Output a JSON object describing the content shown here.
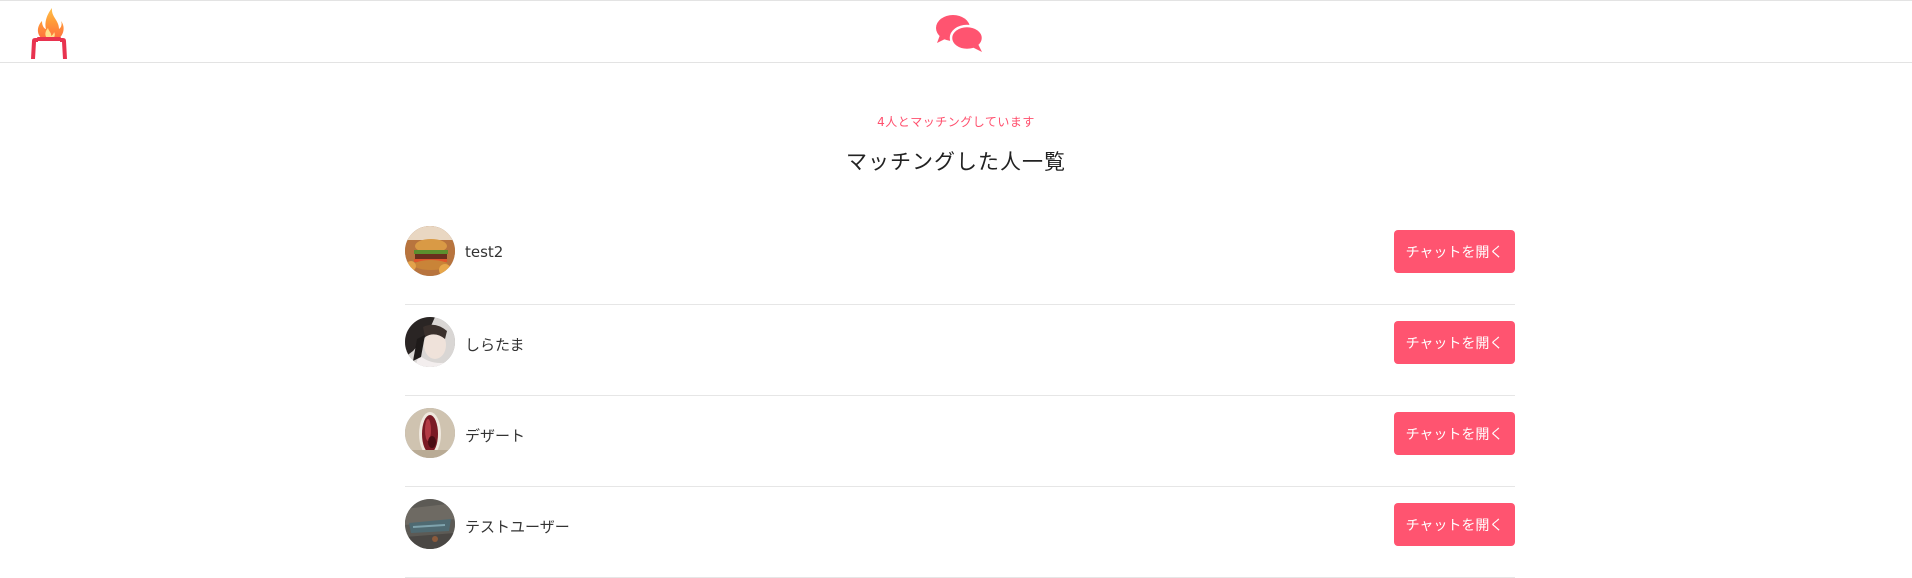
{
  "header": {
    "logo_icon": "flame-logo-icon",
    "nav_icon": "chat-bubbles-icon",
    "accent_color": "#ff5470"
  },
  "main": {
    "count_text": "4人とマッチングしています",
    "title": "マッチングした人一覧",
    "matches": [
      {
        "name": "test2",
        "avatar": "burger-photo",
        "button_label": "チャットを開く"
      },
      {
        "name": "しらたま",
        "avatar": "portrait-photo",
        "button_label": "チャットを開く"
      },
      {
        "name": "デザート",
        "avatar": "dessert-glass-photo",
        "button_label": "チャットを開く"
      },
      {
        "name": "テストユーザー",
        "avatar": "stone-texture-photo",
        "button_label": "チャットを開く"
      }
    ]
  }
}
